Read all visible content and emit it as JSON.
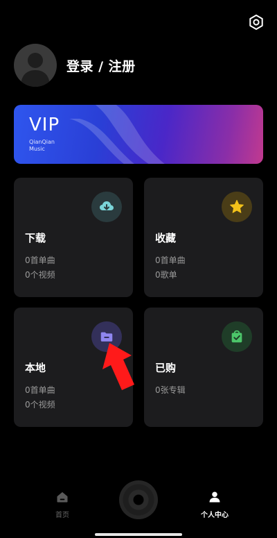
{
  "profile": {
    "login_label": "登录 / 注册"
  },
  "vip": {
    "title": "VIP",
    "sub_line1": "QianQian",
    "sub_line2": "Music"
  },
  "cards": [
    {
      "title": "下载",
      "line1": "0首单曲",
      "line2": "0个视频",
      "icon": "cloud-download-icon",
      "color": "#7ad4d8"
    },
    {
      "title": "收藏",
      "line1": "0首单曲",
      "line2": "0歌单",
      "icon": "star-icon",
      "color": "#f2c21a"
    },
    {
      "title": "本地",
      "line1": "0首单曲",
      "line2": "0个视频",
      "icon": "folder-icon",
      "color": "#8f86f0"
    },
    {
      "title": "已购",
      "line1": "0张专辑",
      "line2": "",
      "icon": "shopping-bag-icon",
      "color": "#4cc66a"
    }
  ],
  "nav": {
    "home_label": "首页",
    "me_label": "个人中心"
  },
  "colors": {
    "background": "#000000",
    "card": "#1c1c1e",
    "annotation_arrow": "#ff1a1a"
  }
}
